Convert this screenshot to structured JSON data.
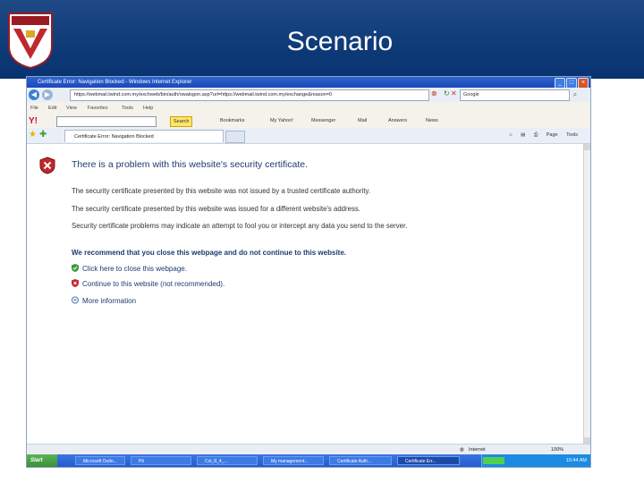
{
  "slide": {
    "title": "Scenario",
    "logo_text": "UPM"
  },
  "browser": {
    "window_title": "Certificate Error: Navigation Blocked - Windows Internet Explorer",
    "url": "https://webmail.twind.com.my/exchweb/bin/auth/owalogon.asp?url=https://webmail.twind.com.my/exchange&reason=0",
    "search_placeholder": "Google",
    "menu": [
      "File",
      "Edit",
      "View",
      "Favorites",
      "Tools",
      "Help"
    ],
    "yahoo_toolbar": {
      "search_label": "Search",
      "items": [
        "Bookmarks",
        "My Yahoo!",
        "Messenger",
        "Mail",
        "Answers",
        "News"
      ]
    },
    "tab_title": "Certificate Error: Navigation Blocked",
    "command_bar": [
      "Page",
      "Tools"
    ]
  },
  "error_page": {
    "heading": "There is a problem with this website's security certificate.",
    "para1": "The security certificate presented by this website was not issued by a trusted certificate authority.",
    "para2": "The security certificate presented by this website was issued for a different website's address.",
    "para3": "Security certificate problems may indicate an attempt to fool you or intercept any data you send to the server.",
    "recommendation": "We recommend that you close this webpage and do not continue to this website.",
    "link_close": "Click here to close this webpage.",
    "link_continue": "Continue to this website (not recommended).",
    "more_info": "More information"
  },
  "status": {
    "zone": "Internet",
    "zoom": "100%"
  },
  "taskbar": {
    "start_label": "Start",
    "items": [
      "Microsoft Outlo...",
      "Pit",
      "Col_8_4_...",
      "My management...",
      "Certificate Auth...",
      "Certificate Err..."
    ],
    "clock": "10:44 AM"
  },
  "colors": {
    "header_bg": "#0e3a78",
    "link": "#1c3a6f",
    "error_red": "#c0282d"
  }
}
